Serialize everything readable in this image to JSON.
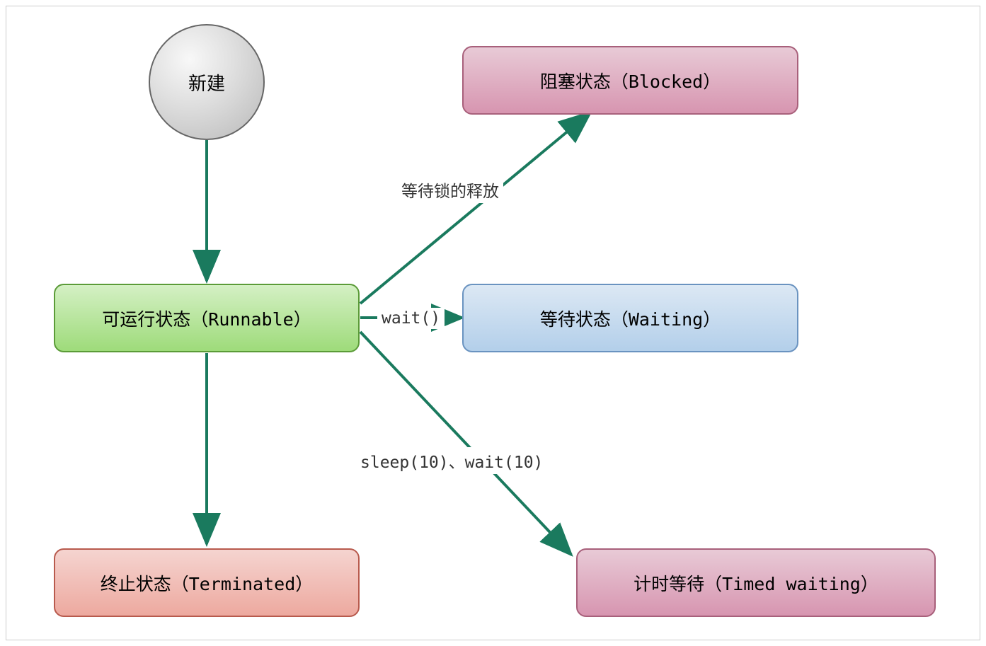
{
  "nodes": {
    "new": "新建",
    "runnable": "可运行状态（Runnable）",
    "terminated": "终止状态（Terminated）",
    "blocked": "阻塞状态（Blocked）",
    "waiting": "等待状态（Waiting）",
    "timed_waiting": "计时等待（Timed waiting）"
  },
  "edges": {
    "to_blocked": "等待锁的释放",
    "to_waiting": "wait()",
    "to_timed_waiting": "sleep(10)、wait(10)"
  },
  "colors": {
    "arrow": "#1a7a5e"
  }
}
